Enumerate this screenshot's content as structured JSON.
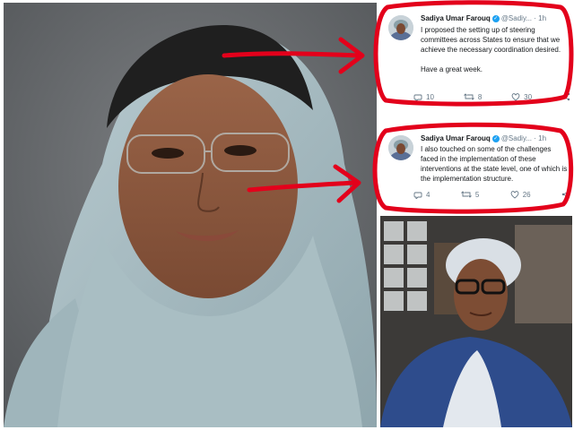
{
  "tweets": [
    {
      "name": "Sadiya Umar Farouq",
      "handle": "@Sadiy...",
      "time": "· 1h",
      "text": "I proposed the setting up of steering committees across States to ensure that we achieve the necessary coordination desired.\n\nHave a great week.",
      "replies": "10",
      "retweets": "8",
      "likes": "30"
    },
    {
      "name": "Sadiya Umar Farouq",
      "handle": "@Sadiy...",
      "time": "· 1h",
      "text": "I also touched on some of the challenges faced in the implementation of these interventions at the state level, one of which is the implementation structure.",
      "replies": "4",
      "retweets": "5",
      "likes": "26"
    }
  ],
  "icons": {
    "reply": "reply-icon",
    "retweet": "retweet-icon",
    "like": "heart-icon",
    "share": "share-icon",
    "verified": "verified-badge-icon"
  },
  "colors": {
    "annotation_red": "#e3001b",
    "twitter_blue": "#1da1f2",
    "hijab_blue": "#a8bcc1"
  }
}
